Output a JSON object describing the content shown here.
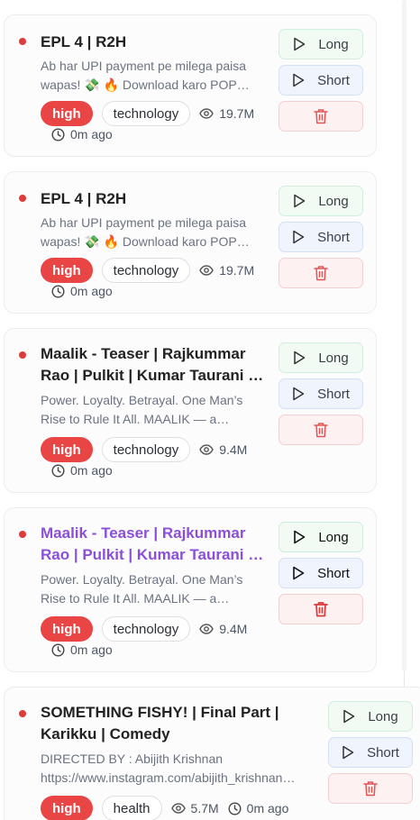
{
  "cards": [
    {
      "title": "EPL 4 | R2H",
      "description": "Ab har UPI payment pe milega paisa wapas! 💸 🔥 Download karo POP…",
      "priority": "high",
      "category": "technology",
      "views": "19.7M",
      "time_ago": "0m ago"
    },
    {
      "title": "EPL 4 | R2H",
      "description": "Ab har UPI payment pe milega paisa wapas! 💸 🔥 Download karo POP…",
      "priority": "high",
      "category": "technology",
      "views": "19.7M",
      "time_ago": "0m ago"
    },
    {
      "title": "Maalik - Teaser | Rajkummar Rao | Pulkit | Kumar Taurani …",
      "description": "Power. Loyalty. Betrayal. One Man’s Rise to Rule It All. MAALIK — a…",
      "priority": "high",
      "category": "technology",
      "views": "9.4M",
      "time_ago": "0m ago"
    },
    {
      "title": "Maalik - Teaser | Rajkummar Rao | Pulkit | Kumar Taurani …",
      "description": "Power. Loyalty. Betrayal. One Man’s Rise to Rule It All. MAALIK — a…",
      "priority": "high",
      "category": "technology",
      "views": "9.4M",
      "time_ago": "0m ago"
    },
    {
      "title": "SOMETHING FISHY! | Final Part | Karikku | Comedy",
      "description": "DIRECTED BY : Abijith Krishnan https://www.instagram.com/abijith_krishnan…",
      "priority": "high",
      "category": "health",
      "views": "5.7M",
      "time_ago": "0m ago"
    }
  ],
  "buttons": {
    "long_label": "Long",
    "short_label": "Short"
  },
  "icons": {
    "play": "play-icon",
    "trash": "trash-icon",
    "eye": "eye-icon",
    "clock": "clock-icon"
  },
  "colors": {
    "priority_high": "#e94545",
    "status_dot": "#e03b3b",
    "active_title": "#8b4fd8",
    "long_bg": "#f1fbf3",
    "short_bg": "#eff4fd",
    "delete_bg": "#fdf1f1",
    "delete_icon": "#e25555"
  }
}
